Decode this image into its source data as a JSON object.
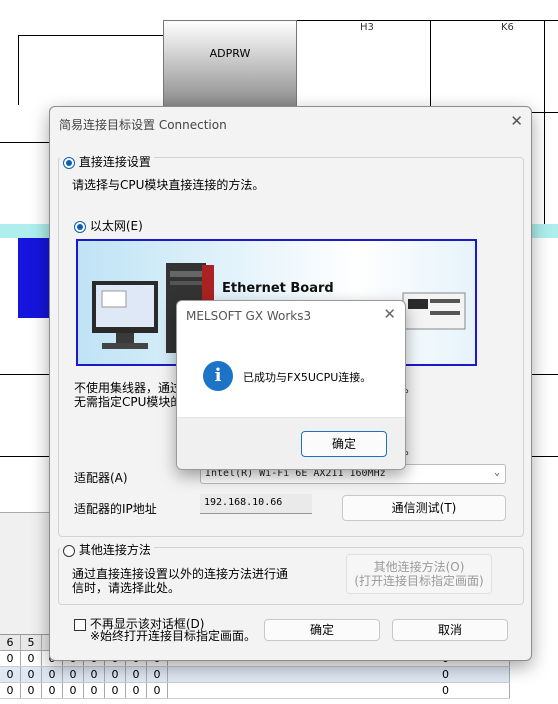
{
  "background": {
    "block_label": "ADPRW",
    "column_labels": [
      "H3",
      "K6"
    ],
    "grid": {
      "headers": [
        "6",
        "5"
      ],
      "rows": [
        [
          "0",
          "0",
          "0",
          "0",
          "0",
          "0",
          "0",
          "0"
        ],
        [
          "0",
          "0",
          "0",
          "0",
          "0",
          "0",
          "0",
          "0"
        ],
        [
          "0",
          "0",
          "0",
          "0",
          "0",
          "0",
          "0",
          "0"
        ]
      ],
      "tail_value": "0",
      "tail_suffix": ".."
    }
  },
  "dialog": {
    "title": "简易连接目标设置 Connection",
    "direct": {
      "label": "直接连接设置",
      "description": "请选择与CPU模块直接连接的方法。",
      "ethernet_label": "以太网(E)",
      "banner_text": "Ethernet Board",
      "note_line1": "不使用集线器，通过",
      "note_line2": "无需指定CPU模块的",
      "note_tail1": "。",
      "note_tail2": "。",
      "adapter_label": "适配器(A)",
      "adapter_value": "Intel(R) Wi-Fi 6E AX211 160MHz",
      "ip_label": "适配器的IP地址",
      "ip_value": "192.168.10.66",
      "test_button": "通信测试(T)"
    },
    "other": {
      "label": "其他连接方法",
      "description_line1": "通过直接连接设置以外的连接方法进行通",
      "description_line2": "信时，请选择此处。",
      "button_line1": "其他连接方法(O)",
      "button_line2": "(打开连接目标指定画面)"
    },
    "footer": {
      "checkbox_label": "不再显示该对话框(D)",
      "checkbox_note": "※始终打开连接目标指定画面。",
      "ok": "确定",
      "cancel": "取消"
    }
  },
  "message_box": {
    "title": "MELSOFT GX Works3",
    "text": "已成功与FX5UCPU连接。",
    "ok": "确定"
  },
  "colors": {
    "accent": "#0a5fb4",
    "cyan_band": "#aeeeee",
    "blue_block": "#1515dd",
    "info_icon": "#1c74c7"
  }
}
